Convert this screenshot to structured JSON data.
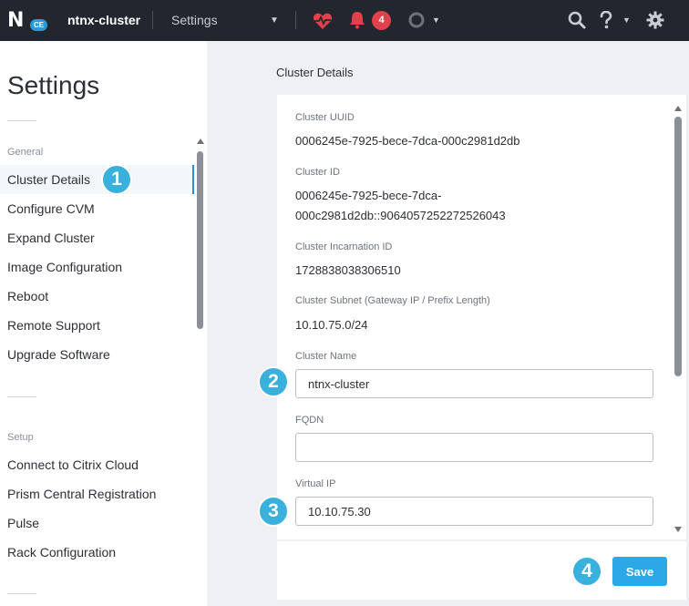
{
  "topbar": {
    "logo_letter": "N",
    "logo_edition": "CE",
    "cluster_name": "ntnx-cluster",
    "page": "Settings",
    "alerts_count": "4"
  },
  "colors": {
    "topbar_bg": "#22262e",
    "accent": "#2ba8e8",
    "callout": "#3ab0dd",
    "alert_badge": "#e0414a",
    "health_heart": "#e0414a"
  },
  "icons": {
    "health": "heart-pulse-icon",
    "alerts": "bell-icon",
    "tasks": "circle-icon",
    "search": "search-icon",
    "help": "question-icon",
    "settings": "gear-icon"
  },
  "leftnav": {
    "title": "Settings",
    "sections": [
      {
        "name": "General",
        "items": [
          "Cluster Details",
          "Configure CVM",
          "Expand Cluster",
          "Image Configuration",
          "Reboot",
          "Remote Support",
          "Upgrade Software"
        ]
      },
      {
        "name": "Setup",
        "items": [
          "Connect to Citrix Cloud",
          "Prism Central Registration",
          "Pulse",
          "Rack Configuration"
        ]
      }
    ],
    "active_item": "Cluster Details"
  },
  "main": {
    "header": "Cluster Details",
    "fields": {
      "uuid_label": "Cluster UUID",
      "uuid_value": "0006245e-7925-bece-7dca-000c2981d2db",
      "id_label": "Cluster ID",
      "id_value_line1": "0006245e-7925-bece-7dca-",
      "id_value_line2": "000c2981d2db::9064057252272526043",
      "incarnation_label": "Cluster Incarnation ID",
      "incarnation_value": "1728838038306510",
      "subnet_label": "Cluster Subnet (Gateway IP / Prefix Length)",
      "subnet_value": "10.10.75.0/24",
      "name_label": "Cluster Name",
      "name_value": "ntnx-cluster",
      "fqdn_label": "FQDN",
      "fqdn_value": "",
      "vip_label": "Virtual IP",
      "vip_value": "10.10.75.30"
    },
    "save_label": "Save"
  },
  "callouts": [
    "1",
    "2",
    "3",
    "4"
  ]
}
